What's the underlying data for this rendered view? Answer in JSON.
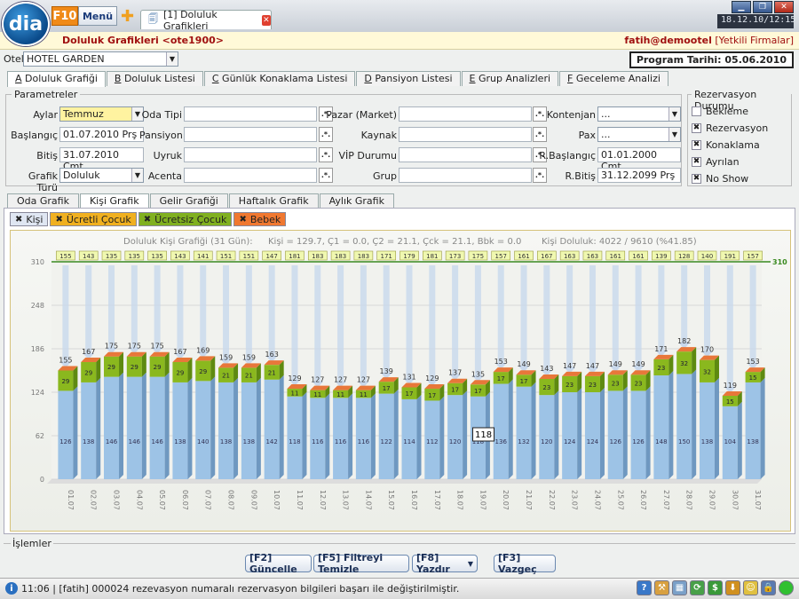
{
  "app": {
    "logo": "dia",
    "f10": "F10",
    "menu": "Menü",
    "tab_label": "[1] Doluluk Grafikleri",
    "clock": "18.12.10/12:15"
  },
  "header": {
    "title": "Doluluk Grafikleri <ote1900>",
    "user": "fatih@demootel",
    "firms": "[Yetkili Firmalar]"
  },
  "otel": {
    "label": "Otel",
    "value": "HOTEL GARDEN"
  },
  "program_date": "Program Tarihi: 05.06.2010",
  "main_tabs": [
    {
      "key": "A",
      "label": " Doluluk Grafiği"
    },
    {
      "key": "B",
      "label": " Doluluk Listesi"
    },
    {
      "key": "C",
      "label": " Günlük Konaklama Listesi"
    },
    {
      "key": "D",
      "label": " Pansiyon Listesi"
    },
    {
      "key": "E",
      "label": " Grup Analizleri"
    },
    {
      "key": "F",
      "label": " Geceleme Analizi"
    }
  ],
  "params": {
    "legend": "Parametreler",
    "aylar_label": "Aylar",
    "aylar_value": "Temmuz",
    "baslangic_label": "Başlangıç",
    "baslangic_value": "01.07.2010 Prş",
    "bitis_label": "Bitiş",
    "bitis_value": "31.07.2010 Cmt",
    "grafik_label": "Grafik Türü",
    "grafik_value": "Doluluk",
    "oda_tipi": "Oda Tipi",
    "pansiyon": "Pansiyon",
    "uyruk": "Uyruk",
    "acenta": "Acenta",
    "pazar": "Pazar (Market)",
    "kaynak": "Kaynak",
    "vip": "VİP Durumu",
    "grup": "Grup",
    "kontenjan": "Kontenjan",
    "kontenjan_value": "...",
    "pax": "Pax",
    "pax_value": "...",
    "rbas": "R.Başlangıç",
    "rbas_value": "01.01.2000 Cmt",
    "rbit": "R.Bitiş",
    "rbit_value": "31.12.2099 Prş",
    "dotbtn": ".*."
  },
  "rezervasyon": {
    "legend": "Rezervasyon Durumu",
    "items": [
      {
        "label": "Bekleme",
        "checked": ""
      },
      {
        "label": "Rezervasyon",
        "checked": "✖"
      },
      {
        "label": "Konaklama",
        "checked": "✖"
      },
      {
        "label": "Ayrılan",
        "checked": "✖"
      },
      {
        "label": "No Show",
        "checked": "✖"
      }
    ]
  },
  "sub_tabs": [
    "Oda Grafik",
    "Kişi Grafik",
    "Gelir Grafiği",
    "Haftalık Grafik",
    "Aylık Grafik"
  ],
  "filters": [
    {
      "label": "Kişi",
      "color": "#dfe6f2",
      "mark": "✖"
    },
    {
      "label": "Ücretli Çocuk",
      "color": "#f0b020",
      "mark": "✖"
    },
    {
      "label": "Ücretsiz Çocuk",
      "color": "#80b020",
      "mark": "✖"
    },
    {
      "label": "Bebek",
      "color": "#f07830",
      "mark": "✖"
    }
  ],
  "chart_data": {
    "type": "bar",
    "title": "Doluluk Kişi Grafiği (31 Gün):",
    "stats": "Kişi = 129.7, Ç1 = 0.0, Ç2 = 21.1, Çck = 21.1, Bbk = 0.0",
    "occupancy": "Kişi Doluluk: 4022 / 9610 (%41.85)",
    "ylim": [
      0,
      310
    ],
    "yticks": [
      0,
      62,
      124,
      186,
      248,
      310
    ],
    "ref_line": 310,
    "ref_label": "310",
    "tooltip": "118",
    "categories": [
      "01.07",
      "02.07",
      "03.07",
      "04.07",
      "05.07",
      "06.07",
      "07.07",
      "08.07",
      "09.07",
      "10.07",
      "11.07",
      "12.07",
      "13.07",
      "14.07",
      "15.07",
      "16.07",
      "17.07",
      "18.07",
      "19.07",
      "20.07",
      "21.07",
      "22.07",
      "23.07",
      "24.07",
      "25.07",
      "26.07",
      "27.07",
      "28.07",
      "29.07",
      "30.07",
      "31.07"
    ],
    "series": [
      {
        "name": "Kişi",
        "values": [
          126,
          138,
          146,
          146,
          146,
          138,
          140,
          138,
          138,
          142,
          118,
          116,
          116,
          116,
          122,
          114,
          112,
          120,
          118,
          136,
          132,
          120,
          124,
          124,
          126,
          126,
          148,
          150,
          138,
          104,
          138
        ]
      },
      {
        "name": "Ücretsiz Çocuk",
        "values": [
          29,
          29,
          29,
          29,
          29,
          29,
          29,
          21,
          21,
          21,
          11,
          11,
          11,
          11,
          17,
          17,
          17,
          17,
          17,
          17,
          17,
          23,
          23,
          23,
          23,
          23,
          23,
          32,
          32,
          15,
          15
        ]
      }
    ],
    "totals": [
      155,
      167,
      175,
      175,
      175,
      167,
      169,
      159,
      159,
      163,
      129,
      127,
      127,
      127,
      139,
      131,
      129,
      137,
      135,
      153,
      149,
      143,
      147,
      147,
      149,
      149,
      171,
      182,
      170,
      119,
      153
    ],
    "available": [
      155,
      143,
      135,
      135,
      135,
      143,
      141,
      151,
      151,
      147,
      181,
      183,
      183,
      183,
      171,
      179,
      181,
      173,
      175,
      157,
      161,
      167,
      163,
      163,
      161,
      161,
      139,
      128,
      140,
      191,
      157
    ]
  },
  "islemler": {
    "legend": "İşlemler",
    "buttons": [
      "[F2] Güncelle",
      "[F5] Filtreyi Temizle",
      "[F8] Yazdır",
      "[F3] Vazgeç"
    ]
  },
  "status": {
    "message": "11:06 | [fatih] 000024 rezevasyon numaralı rezervasyon bilgileri başarı ile değiştirilmiştir."
  }
}
